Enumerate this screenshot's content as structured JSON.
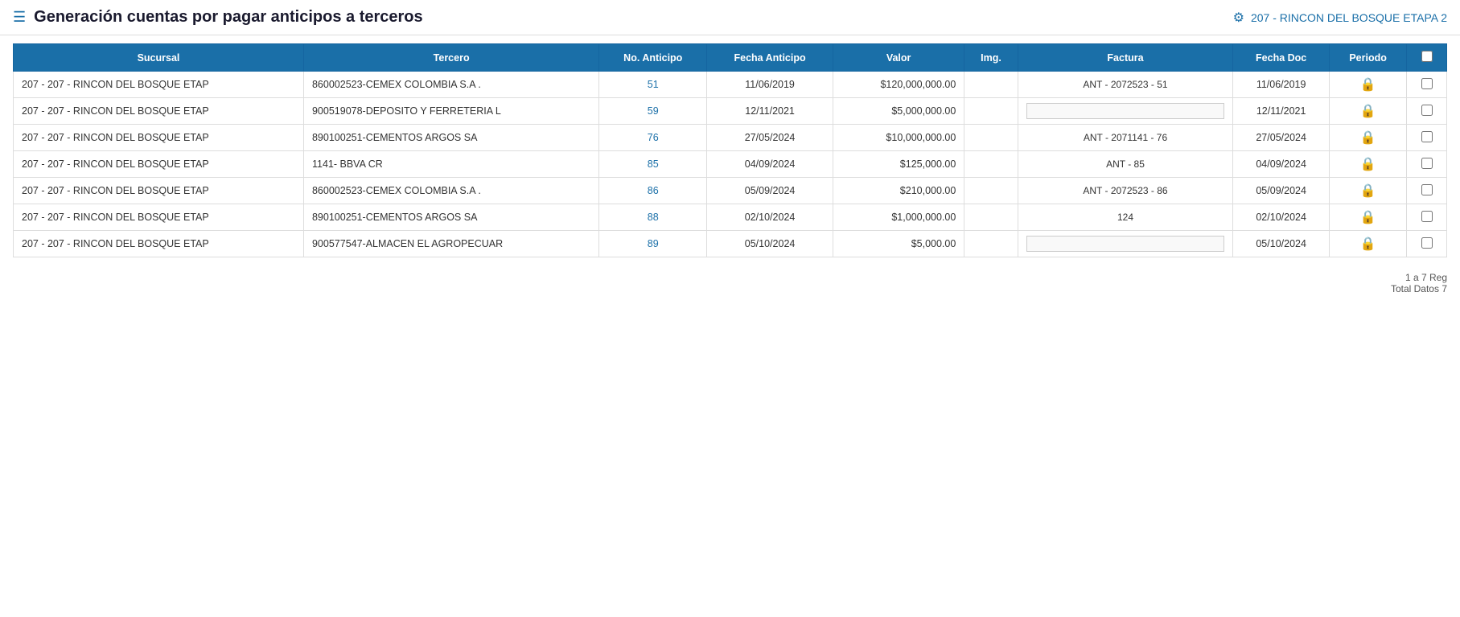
{
  "header": {
    "menu_icon": "☰",
    "title": "Generación cuentas por pagar anticipos a terceros",
    "gear_icon": "⚙",
    "company": "207 - RINCON DEL BOSQUE ETAPA 2"
  },
  "table": {
    "columns": [
      "Sucursal",
      "Tercero",
      "No. Anticipo",
      "Fecha Anticipo",
      "Valor",
      "Img.",
      "Factura",
      "Fecha Doc",
      "Periodo",
      ""
    ],
    "rows": [
      {
        "sucursal": "207 - 207 - RINCON DEL BOSQUE ETAP",
        "tercero": "860002523-CEMEX COLOMBIA S.A .",
        "no_anticipo": "51",
        "fecha_anticipo": "11/06/2019",
        "valor": "$120,000,000.00",
        "img": "",
        "factura": "ANT - 2072523 - 51",
        "factura_editable": false,
        "fecha_doc": "11/06/2019",
        "periodo": "lock",
        "checked": false
      },
      {
        "sucursal": "207 - 207 - RINCON DEL BOSQUE ETAP",
        "tercero": "900519078-DEPOSITO Y FERRETERIA L",
        "no_anticipo": "59",
        "fecha_anticipo": "12/11/2021",
        "valor": "$5,000,000.00",
        "img": "",
        "factura": "",
        "factura_editable": true,
        "fecha_doc": "12/11/2021",
        "periodo": "lock",
        "checked": false
      },
      {
        "sucursal": "207 - 207 - RINCON DEL BOSQUE ETAP",
        "tercero": "890100251-CEMENTOS ARGOS SA",
        "no_anticipo": "76",
        "fecha_anticipo": "27/05/2024",
        "valor": "$10,000,000.00",
        "img": "",
        "factura": "ANT - 2071141 - 76",
        "factura_editable": false,
        "fecha_doc": "27/05/2024",
        "periodo": "lock",
        "checked": false
      },
      {
        "sucursal": "207 - 207 - RINCON DEL BOSQUE ETAP",
        "tercero": "1141- BBVA CR",
        "no_anticipo": "85",
        "fecha_anticipo": "04/09/2024",
        "valor": "$125,000.00",
        "img": "",
        "factura": "ANT - 85",
        "factura_editable": false,
        "fecha_doc": "04/09/2024",
        "periodo": "lock",
        "checked": false
      },
      {
        "sucursal": "207 - 207 - RINCON DEL BOSQUE ETAP",
        "tercero": "860002523-CEMEX COLOMBIA S.A .",
        "no_anticipo": "86",
        "fecha_anticipo": "05/09/2024",
        "valor": "$210,000.00",
        "img": "",
        "factura": "ANT - 2072523 - 86",
        "factura_editable": false,
        "fecha_doc": "05/09/2024",
        "periodo": "lock",
        "checked": false
      },
      {
        "sucursal": "207 - 207 - RINCON DEL BOSQUE ETAP",
        "tercero": "890100251-CEMENTOS ARGOS SA",
        "no_anticipo": "88",
        "fecha_anticipo": "02/10/2024",
        "valor": "$1,000,000.00",
        "img": "",
        "factura": "124",
        "factura_editable": false,
        "fecha_doc": "02/10/2024",
        "periodo": "lock",
        "checked": false
      },
      {
        "sucursal": "207 - 207 - RINCON DEL BOSQUE ETAP",
        "tercero": "900577547-ALMACEN EL AGROPECUAR",
        "no_anticipo": "89",
        "fecha_anticipo": "05/10/2024",
        "valor": "$5,000.00",
        "img": "",
        "factura": "",
        "factura_editable": true,
        "fecha_doc": "05/10/2024",
        "periodo": "lock",
        "checked": false
      }
    ],
    "pagination": {
      "range": "1 a 7 Reg",
      "total": "Total Datos 7"
    }
  }
}
